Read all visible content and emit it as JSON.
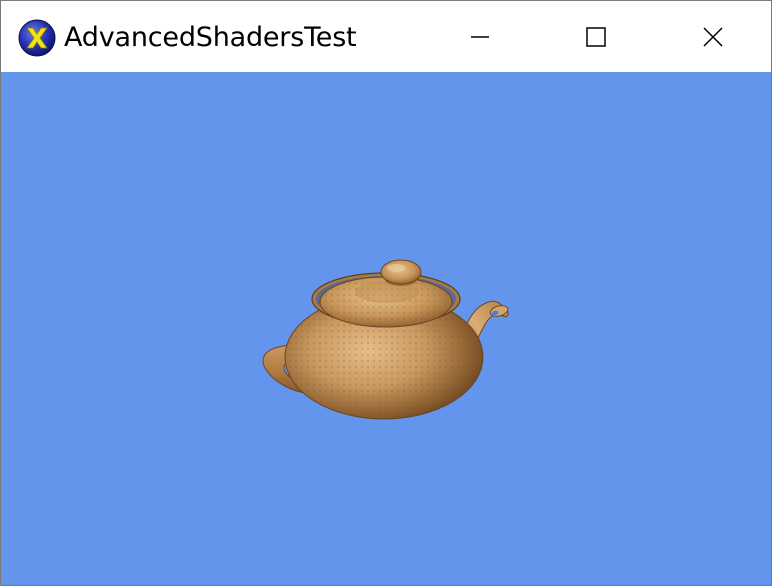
{
  "window": {
    "title": "AdvancedShadersTest",
    "app_icon": "directx-x-icon",
    "buttons": {
      "minimize_icon": "minimize-icon",
      "maximize_icon": "maximize-icon",
      "close_icon": "close-icon"
    }
  },
  "colors": {
    "titlebar_bg": "#ffffff",
    "client_bg": "#6495ed",
    "teapot_base": "#c9995f",
    "icon_yellow": "#f2e318",
    "icon_blue": "#1e2aa8"
  },
  "scene": {
    "object": "teapot"
  }
}
